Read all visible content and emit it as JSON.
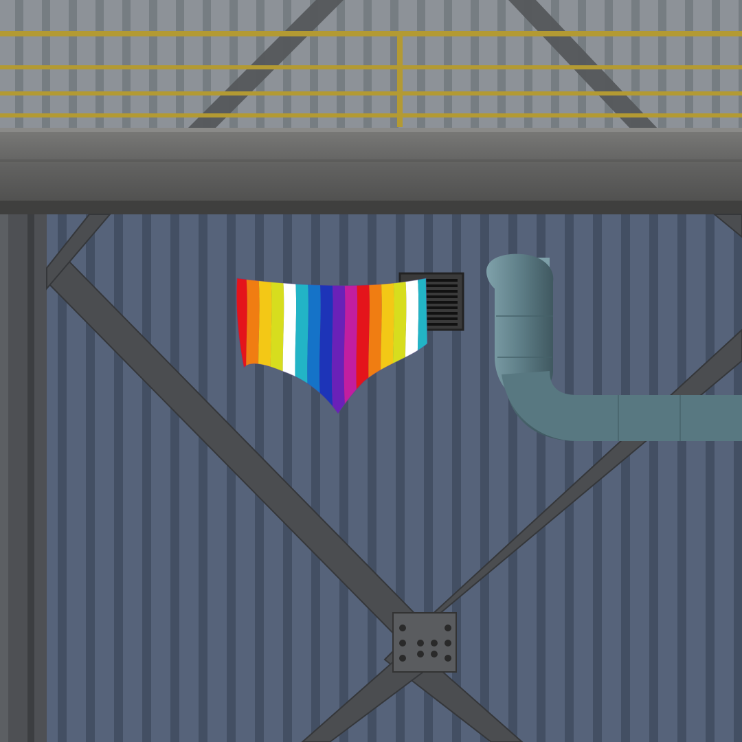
{
  "scene": {
    "type": "game-world-view",
    "subject": "rainbow-striped-garment-item",
    "garment_stripe_colors": [
      "#e4141b",
      "#f07d12",
      "#f3c816",
      "#d7dd1e",
      "#ffffff",
      "#22b4c6",
      "#1573c8",
      "#1d34b8",
      "#6a21b8",
      "#c21ea0",
      "#e4141b",
      "#f07d12",
      "#f3c816",
      "#d7dd1e",
      "#ffffff",
      "#22b4c6"
    ],
    "colors": {
      "upper_wall": "#8d9298",
      "upper_wall_dark": "#6f757b",
      "railing": "#b39a33",
      "beam": "#6a6a68",
      "lower_wall": "#56637a",
      "lower_wall_dark": "#3f4a5e",
      "girder": "#4b4d50",
      "pipe": "#5f7f88",
      "vent": "#3a3a3a"
    }
  }
}
